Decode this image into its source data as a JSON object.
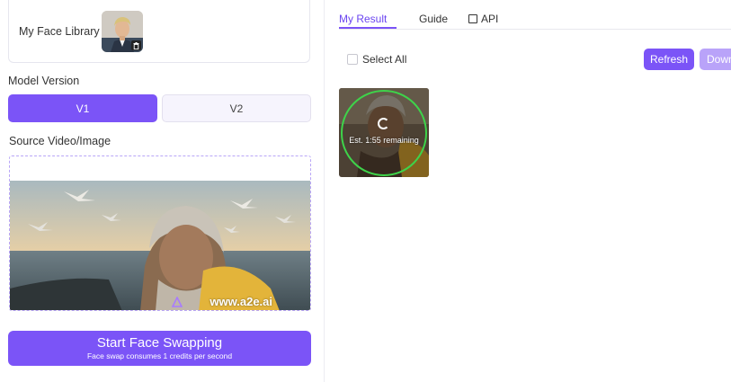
{
  "left": {
    "face_library_label": "My Face Library",
    "model_version_label": "Model Version",
    "model_options": [
      "V1",
      "V2"
    ],
    "model_selected": "V1",
    "source_label": "Source Video/Image",
    "watermark": "www.a2e.ai",
    "start_button": {
      "title": "Start Face Swapping",
      "subtitle": "Face swap consumes 1 credits per second"
    }
  },
  "right": {
    "tabs": [
      "My Result",
      "Guide",
      "API"
    ],
    "active_tab": "My Result",
    "select_all_label": "Select All",
    "refresh_label": "Refresh",
    "download_label": "Down",
    "result_eta": "Est. 1:55 remaining"
  },
  "colors": {
    "accent": "#7b54f7",
    "accent_light": "#b9a3f9",
    "progress_ring": "#3ed34a"
  },
  "icons": [
    "trash-icon",
    "api-icon",
    "spinner-icon",
    "checkbox"
  ]
}
